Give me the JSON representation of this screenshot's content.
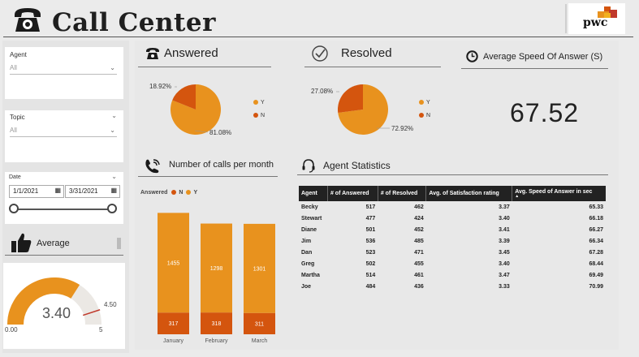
{
  "header": {
    "title": "Call Center",
    "logo_text": "pwc"
  },
  "filters": {
    "agent": {
      "label": "Agent",
      "value": "All"
    },
    "topic": {
      "label": "Topic",
      "value": "All"
    },
    "date": {
      "label": "Date",
      "start": "1/1/2021",
      "end": "3/31/2021"
    }
  },
  "average_card": {
    "title": "Average",
    "value": "3.40",
    "min": "0.00",
    "max": "5",
    "target": "4.50",
    "gauge_fraction": 0.68,
    "target_fraction": 0.9
  },
  "answered": {
    "title": "Answered",
    "slices": [
      {
        "label": "Y",
        "percent": 81.08,
        "text": "81.08%",
        "color": "#e8921e"
      },
      {
        "label": "N",
        "percent": 18.92,
        "text": "18.92%",
        "color": "#d4550e"
      }
    ]
  },
  "resolved": {
    "title": "Resolved",
    "slices": [
      {
        "label": "Y",
        "percent": 72.92,
        "text": "72.92%",
        "color": "#e8921e"
      },
      {
        "label": "N",
        "percent": 27.08,
        "text": "27.08%",
        "color": "#d4550e"
      }
    ]
  },
  "asa": {
    "title": "Average Speed Of  Answer (S)",
    "value": "67.52"
  },
  "calls_chart": {
    "title": "Number of calls per month",
    "legend_title": "Answered",
    "legend": [
      {
        "label": "N",
        "color": "#d4550e"
      },
      {
        "label": "Y",
        "color": "#e8921e"
      }
    ]
  },
  "chart_data": {
    "type": "bar",
    "stacked": true,
    "categories": [
      "January",
      "February",
      "March"
    ],
    "series": [
      {
        "name": "N",
        "values": [
          317,
          318,
          311
        ],
        "color": "#d4550e"
      },
      {
        "name": "Y",
        "values": [
          1455,
          1298,
          1301
        ],
        "color": "#e8921e"
      }
    ],
    "ylim": [
      0,
      1800
    ]
  },
  "agent_stats": {
    "title": "Agent Statistics",
    "columns": [
      "Agent",
      "# of Answered",
      "# of Resolved",
      "Avg. of Satisfaction rating",
      "Avg. Speed of Answer in sec"
    ],
    "rows": [
      [
        "Becky",
        "517",
        "462",
        "3.37",
        "65.33"
      ],
      [
        "Stewart",
        "477",
        "424",
        "3.40",
        "66.18"
      ],
      [
        "Diane",
        "501",
        "452",
        "3.41",
        "66.27"
      ],
      [
        "Jim",
        "536",
        "485",
        "3.39",
        "66.34"
      ],
      [
        "Dan",
        "523",
        "471",
        "3.45",
        "67.28"
      ],
      [
        "Greg",
        "502",
        "455",
        "3.40",
        "68.44"
      ],
      [
        "Martha",
        "514",
        "461",
        "3.47",
        "69.49"
      ],
      [
        "Joe",
        "484",
        "436",
        "3.33",
        "70.99"
      ]
    ]
  }
}
